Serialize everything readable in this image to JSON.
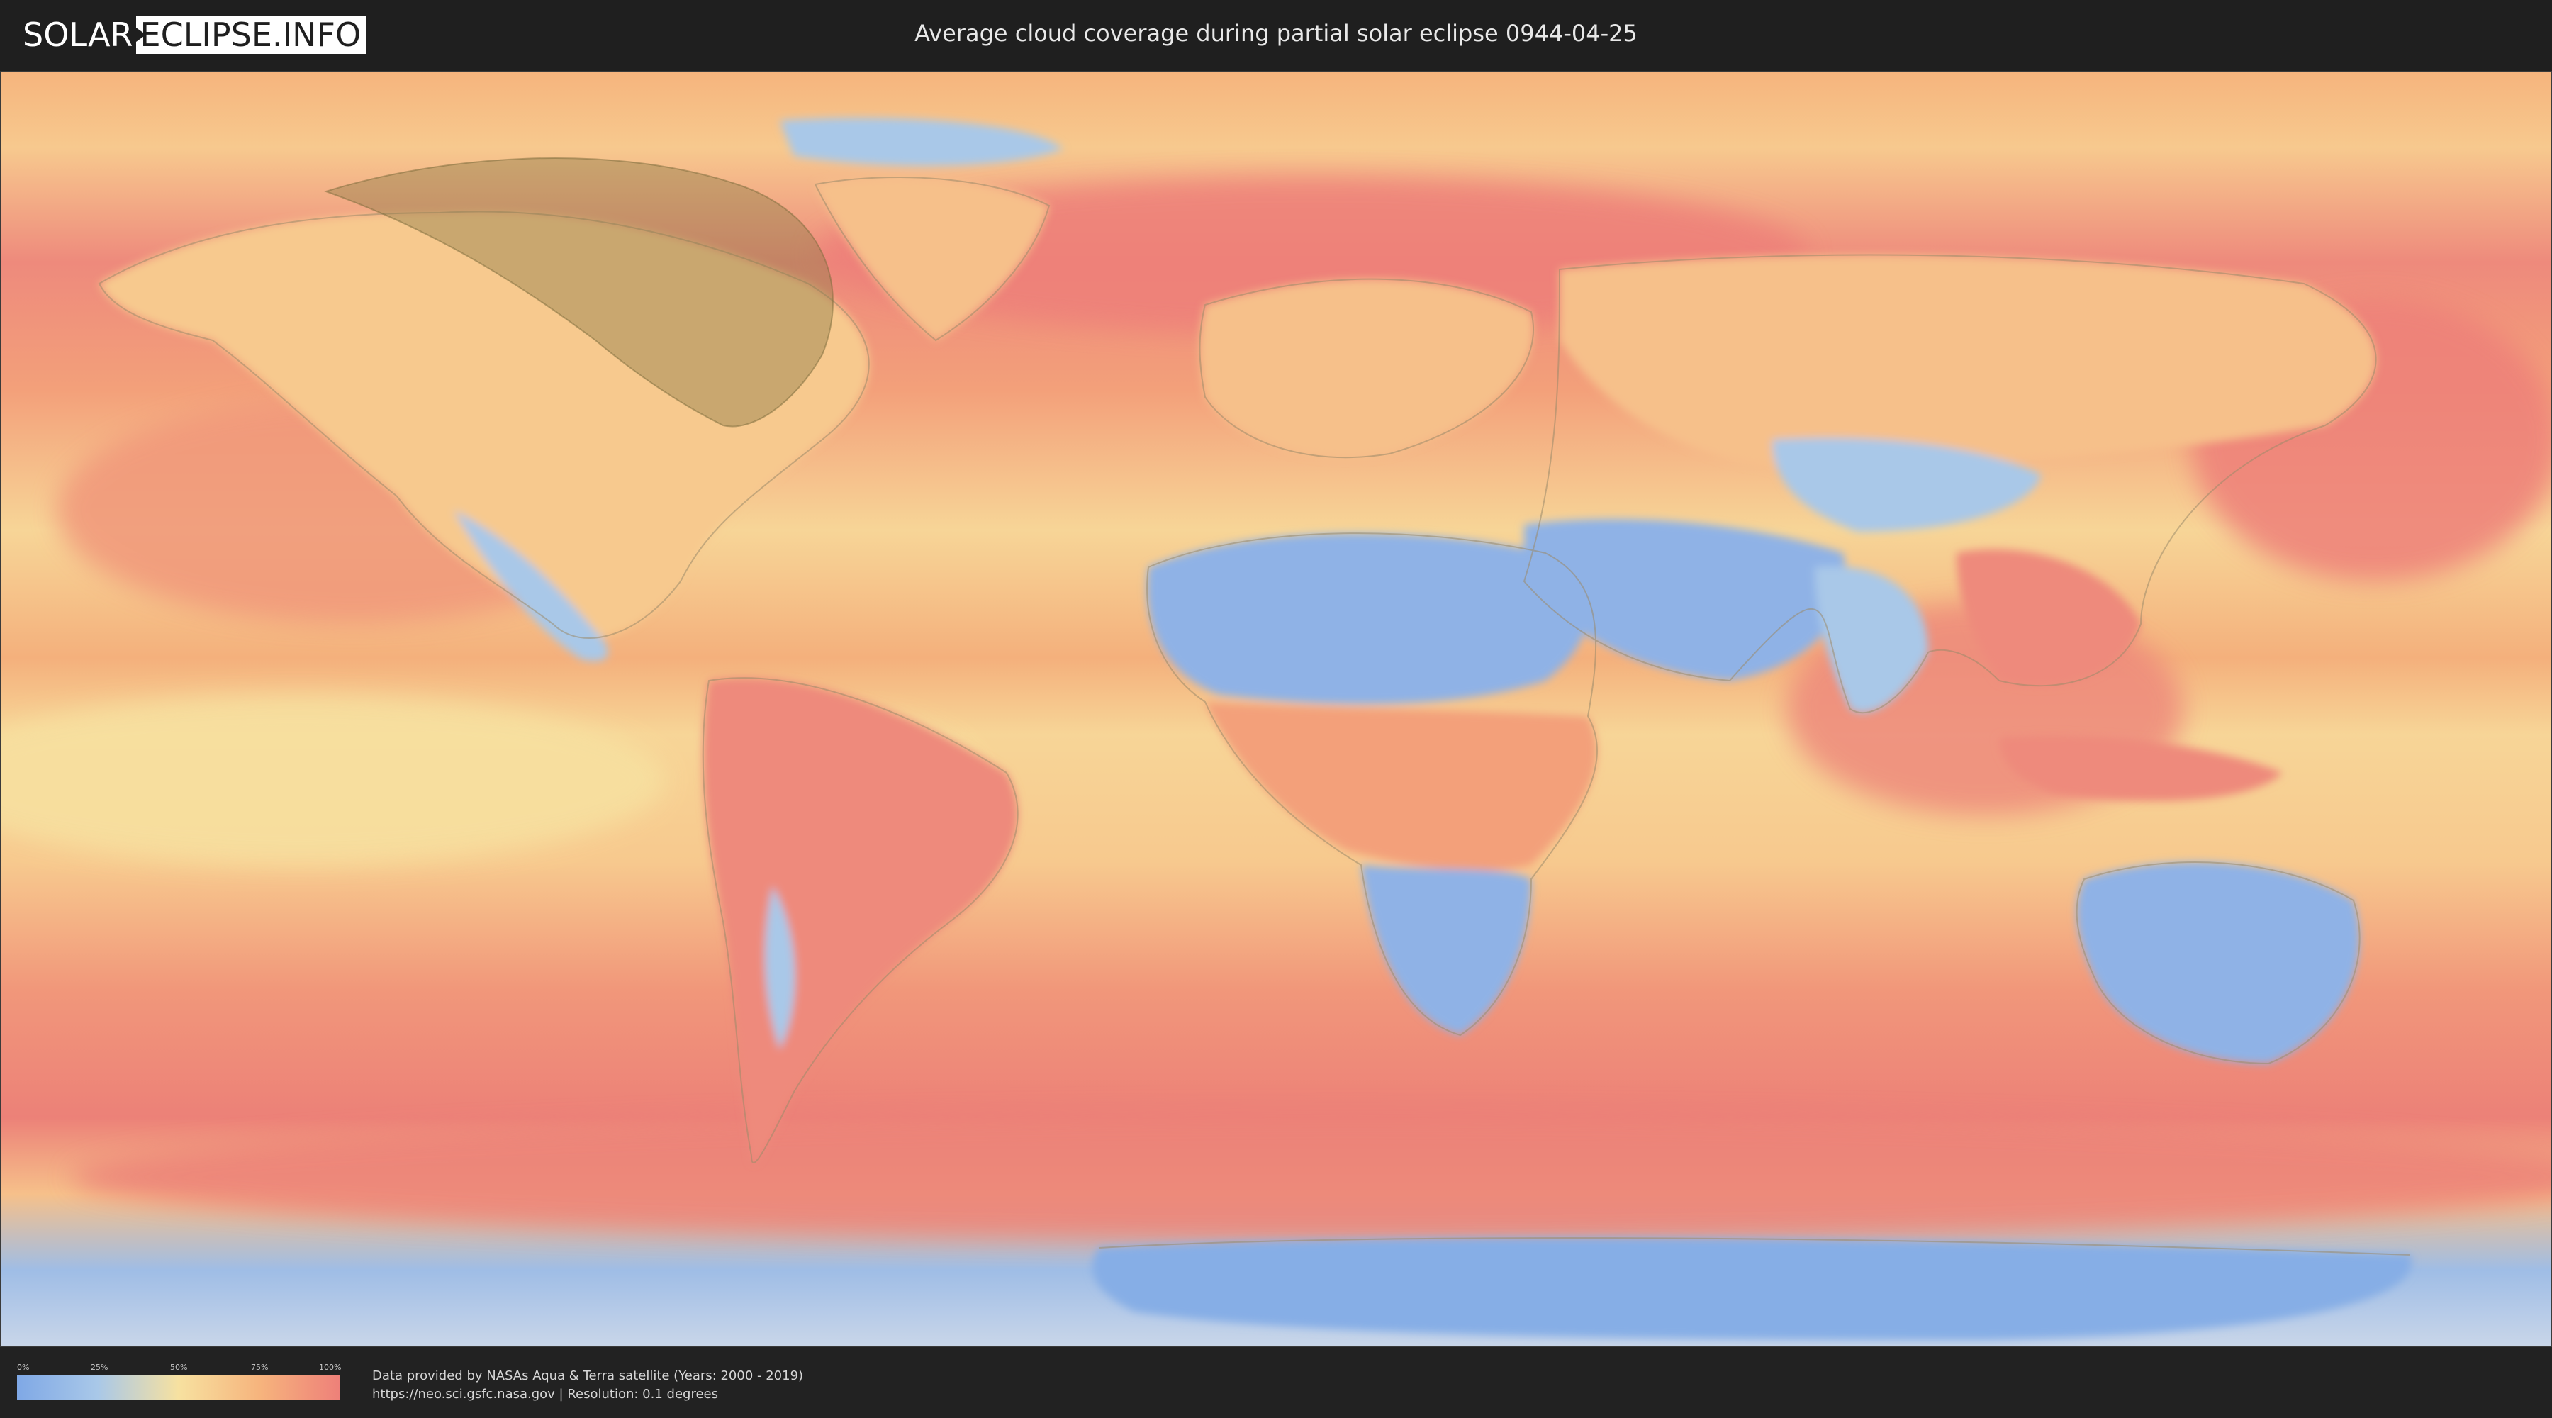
{
  "header": {
    "logo_left": "SOLAR",
    "logo_right": "ECLIPSE.INFO",
    "title": "Average cloud coverage during partial solar eclipse 0944-04-25"
  },
  "map": {
    "kind": "world cloud coverage map",
    "eclipse_zone_color": "#8a7a45",
    "palette": {
      "clear": "#7fa8e6",
      "low": "#a9c8e8",
      "mid": "#f7e1a0",
      "high": "#f6b47d",
      "overcast": "#ee8079",
      "land_outline": "#9a8a6a"
    }
  },
  "legend": {
    "ticks": [
      "0%",
      "25%",
      "50%",
      "75%",
      "100%"
    ]
  },
  "credit": {
    "line1": "Data provided by NASAs Aqua & Terra satellite (Years: 2000 - 2019)",
    "line2": "https://neo.sci.gsfc.nasa.gov | Resolution: 0.1 degrees"
  }
}
